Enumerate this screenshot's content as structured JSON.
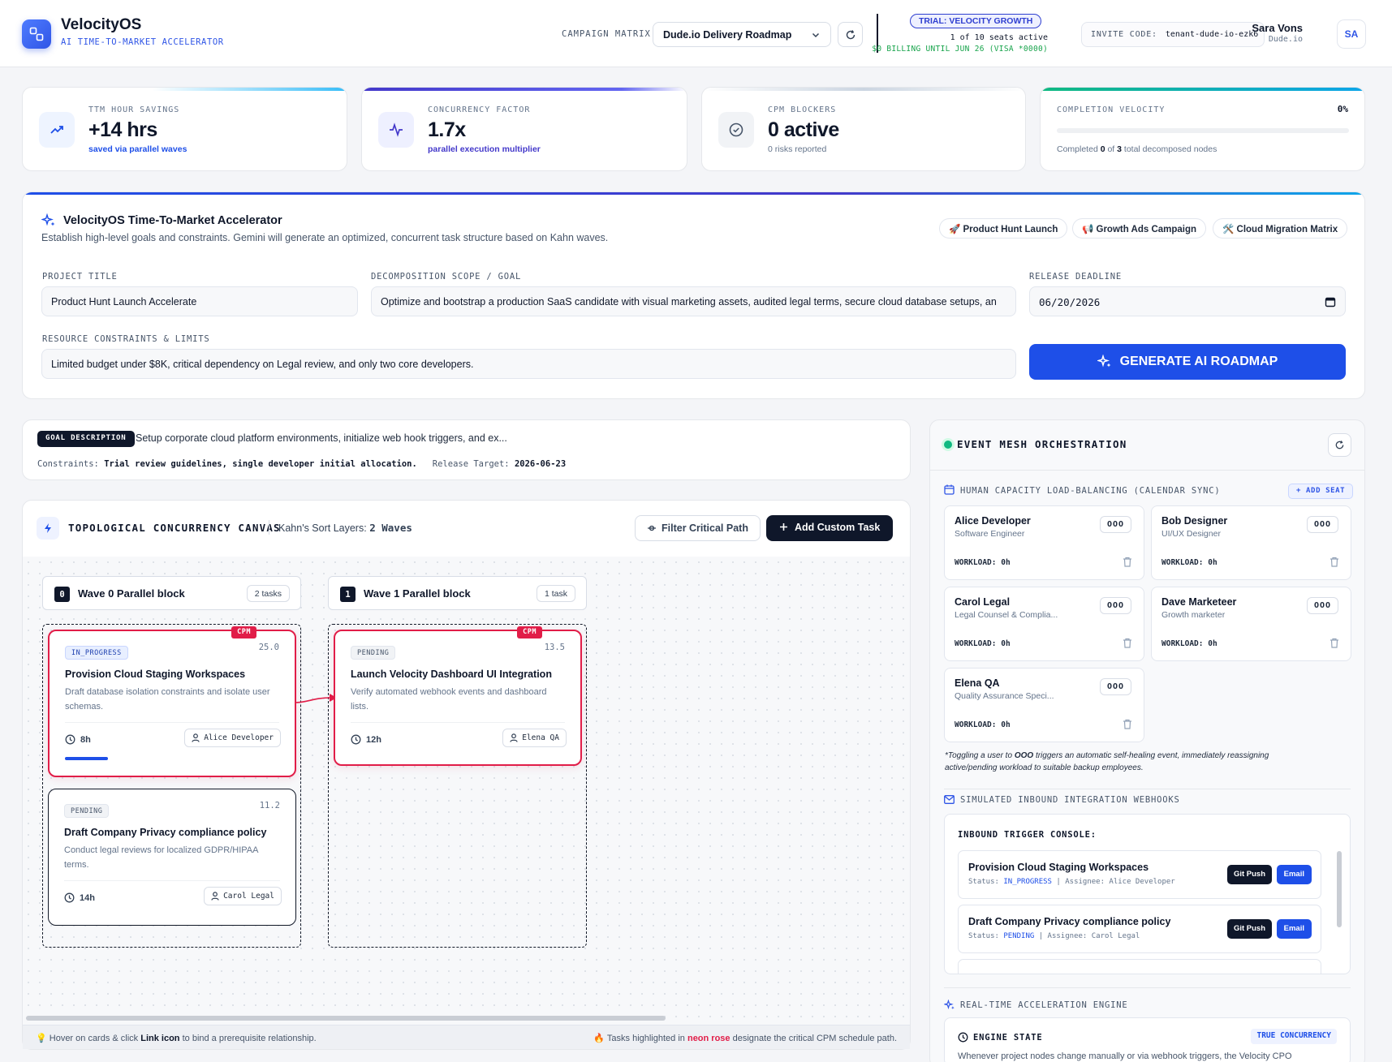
{
  "header": {
    "brand": "VelocityOS",
    "tagline": "AI TIME-TO-MARKET ACCELERATOR",
    "campaign_label": "CAMPAIGN MATRIX:",
    "campaign_value": "Dude.io Delivery Roadmap",
    "trial_badge": "TRIAL: VELOCITY GROWTH",
    "seats": "1 of 10 seats active",
    "billing": "$0 BILLING UNTIL JUN 26 (VISA *0000)",
    "invite_label": "INVITE CODE:",
    "invite_code": "tenant-dude-io-ezk6",
    "user_name": "Sara Vons",
    "user_org": "Dude.io",
    "avatar": "SA"
  },
  "stats": {
    "ttm": {
      "label": "TTM HOUR SAVINGS",
      "value": "+14 hrs",
      "sub": "saved via parallel waves"
    },
    "concurrency": {
      "label": "CONCURRENCY FACTOR",
      "value": "1.7x",
      "sub": "parallel execution multiplier"
    },
    "blockers": {
      "label": "CPM BLOCKERS",
      "value": "0 active",
      "sub": "0 risks reported"
    },
    "velocity": {
      "label": "COMPLETION VELOCITY",
      "percent": "0%",
      "progress": 0,
      "sub_prefix": "Completed",
      "completed": "0",
      "of": "of",
      "total": "3",
      "sub_suffix": "total decomposed nodes"
    }
  },
  "accelerator": {
    "title": "VelocityOS Time-To-Market Accelerator",
    "description": "Establish high-level goals and constraints. Gemini will generate an optimized, concurrent task structure based on Kahn waves.",
    "templates": [
      "🚀 Product Hunt Launch",
      "📢 Growth Ads Campaign",
      "🛠️ Cloud Migration Matrix"
    ],
    "project_title_label": "PROJECT TITLE",
    "project_title": "Product Hunt Launch Accelerate",
    "scope_label": "DECOMPOSITION SCOPE / GOAL",
    "scope": "Optimize and bootstrap a production SaaS candidate with visual marketing assets, audited legal terms, secure cloud database setups, an",
    "deadline_label": "RELEASE DEADLINE",
    "deadline": "06/20/2026",
    "constraints_label": "RESOURCE CONSTRAINTS & LIMITS",
    "constraints": "Limited budget under $8K, critical dependency on Legal review, and only two core developers.",
    "generate_label": "GENERATE AI ROADMAP"
  },
  "goal": {
    "badge": "GOAL DESCRIPTION",
    "text": "Setup corporate cloud platform environments, initialize web hook triggers, and ex...",
    "constraints_label": "Constraints:",
    "constraints": "Trial review guidelines, single developer initial allocation.",
    "release_label": "Release Target:",
    "release": "2026-06-23"
  },
  "canvas": {
    "title": "TOPOLOGICAL CONCURRENCY CANVAS",
    "kahn_label": "Kahn's Sort Layers:",
    "kahn_value": "2 Waves",
    "filter_label": "Filter Critical Path",
    "add_label": "Add Custom Task",
    "waves": [
      {
        "num": "0",
        "name": "Wave 0 Parallel block",
        "count": "2 tasks"
      },
      {
        "num": "1",
        "name": "Wave 1 Parallel block",
        "count": "1 task"
      }
    ],
    "tasks": [
      {
        "status": "IN_PROGRESS",
        "score": "25.0",
        "title": "Provision Cloud Staging Workspaces",
        "desc": "Draft database isolation constraints and isolate user schemas.",
        "hours": "8h",
        "assignee": "Alice Developer",
        "cpm": "CPM"
      },
      {
        "status": "PENDING",
        "score": "11.2",
        "title": "Draft Company Privacy compliance policy",
        "desc": "Conduct legal reviews for localized GDPR/HIPAA terms.",
        "hours": "14h",
        "assignee": "Carol Legal"
      },
      {
        "status": "PENDING",
        "score": "13.5",
        "title": "Launch Velocity Dashboard UI Integration",
        "desc": "Verify automated webhook events and dashboard lists.",
        "hours": "12h",
        "assignee": "Elena QA",
        "cpm": "CPM"
      }
    ],
    "footer_left_pre": "💡 Hover on cards & click",
    "footer_left_bold": "Link icon",
    "footer_left_post": "to bind a prerequisite relationship.",
    "footer_right_pre": "🔥 Tasks highlighted in",
    "footer_right_accent": "neon rose",
    "footer_right_post": "designate the critical CPM schedule path."
  },
  "mesh": {
    "title": "EVENT MESH ORCHESTRATION",
    "capacity_label": "HUMAN CAPACITY LOAD-BALANCING (CALENDAR SYNC)",
    "add_seat": "+ ADD SEAT",
    "seats": [
      {
        "name": "Alice Developer",
        "role": "Software Engineer",
        "workload": "0h"
      },
      {
        "name": "Bob Designer",
        "role": "UI/UX Designer",
        "workload": "0h"
      },
      {
        "name": "Carol Legal",
        "role": "Legal Counsel & Complia...",
        "workload": "0h"
      },
      {
        "name": "Dave Marketeer",
        "role": "Growth marketer",
        "workload": "0h"
      },
      {
        "name": "Elena QA",
        "role": "Quality Assurance Speci...",
        "workload": "0h"
      }
    ],
    "ooo_label": "OOO",
    "workload_label": "WORKLOAD:",
    "note_pre": "*Toggling a user to",
    "note_bold": "OOO",
    "note_post": "triggers an automatic self-healing event, immediately reassigning active/pending workload to suitable backup employees.",
    "webhooks_label": "SIMULATED INBOUND INTEGRATION WEBHOOKS",
    "console_label": "INBOUND TRIGGER CONSOLE:",
    "hooks": [
      {
        "title": "Provision Cloud Staging Workspaces",
        "status_label": "Status:",
        "status": "IN_PROGRESS",
        "assignee_label": "| Assignee:",
        "assignee": "Alice Developer"
      },
      {
        "title": "Draft Company Privacy compliance policy",
        "status_label": "Status:",
        "status": "PENDING",
        "assignee_label": "| Assignee:",
        "assignee": "Carol Legal"
      }
    ],
    "git_push": "Git Push",
    "email": "Email",
    "engine_label": "REAL-TIME ACCELERATION ENGINE",
    "engine_state": "ENGINE STATE",
    "engine_badge": "TRUE CONCURRENCY",
    "engine_text": "Whenever project nodes change manually or via webhook triggers, the Velocity CPO"
  },
  "colors": {
    "accent": "#1e4fe8",
    "critical": "#e11d48",
    "dark": "#0f172a"
  }
}
